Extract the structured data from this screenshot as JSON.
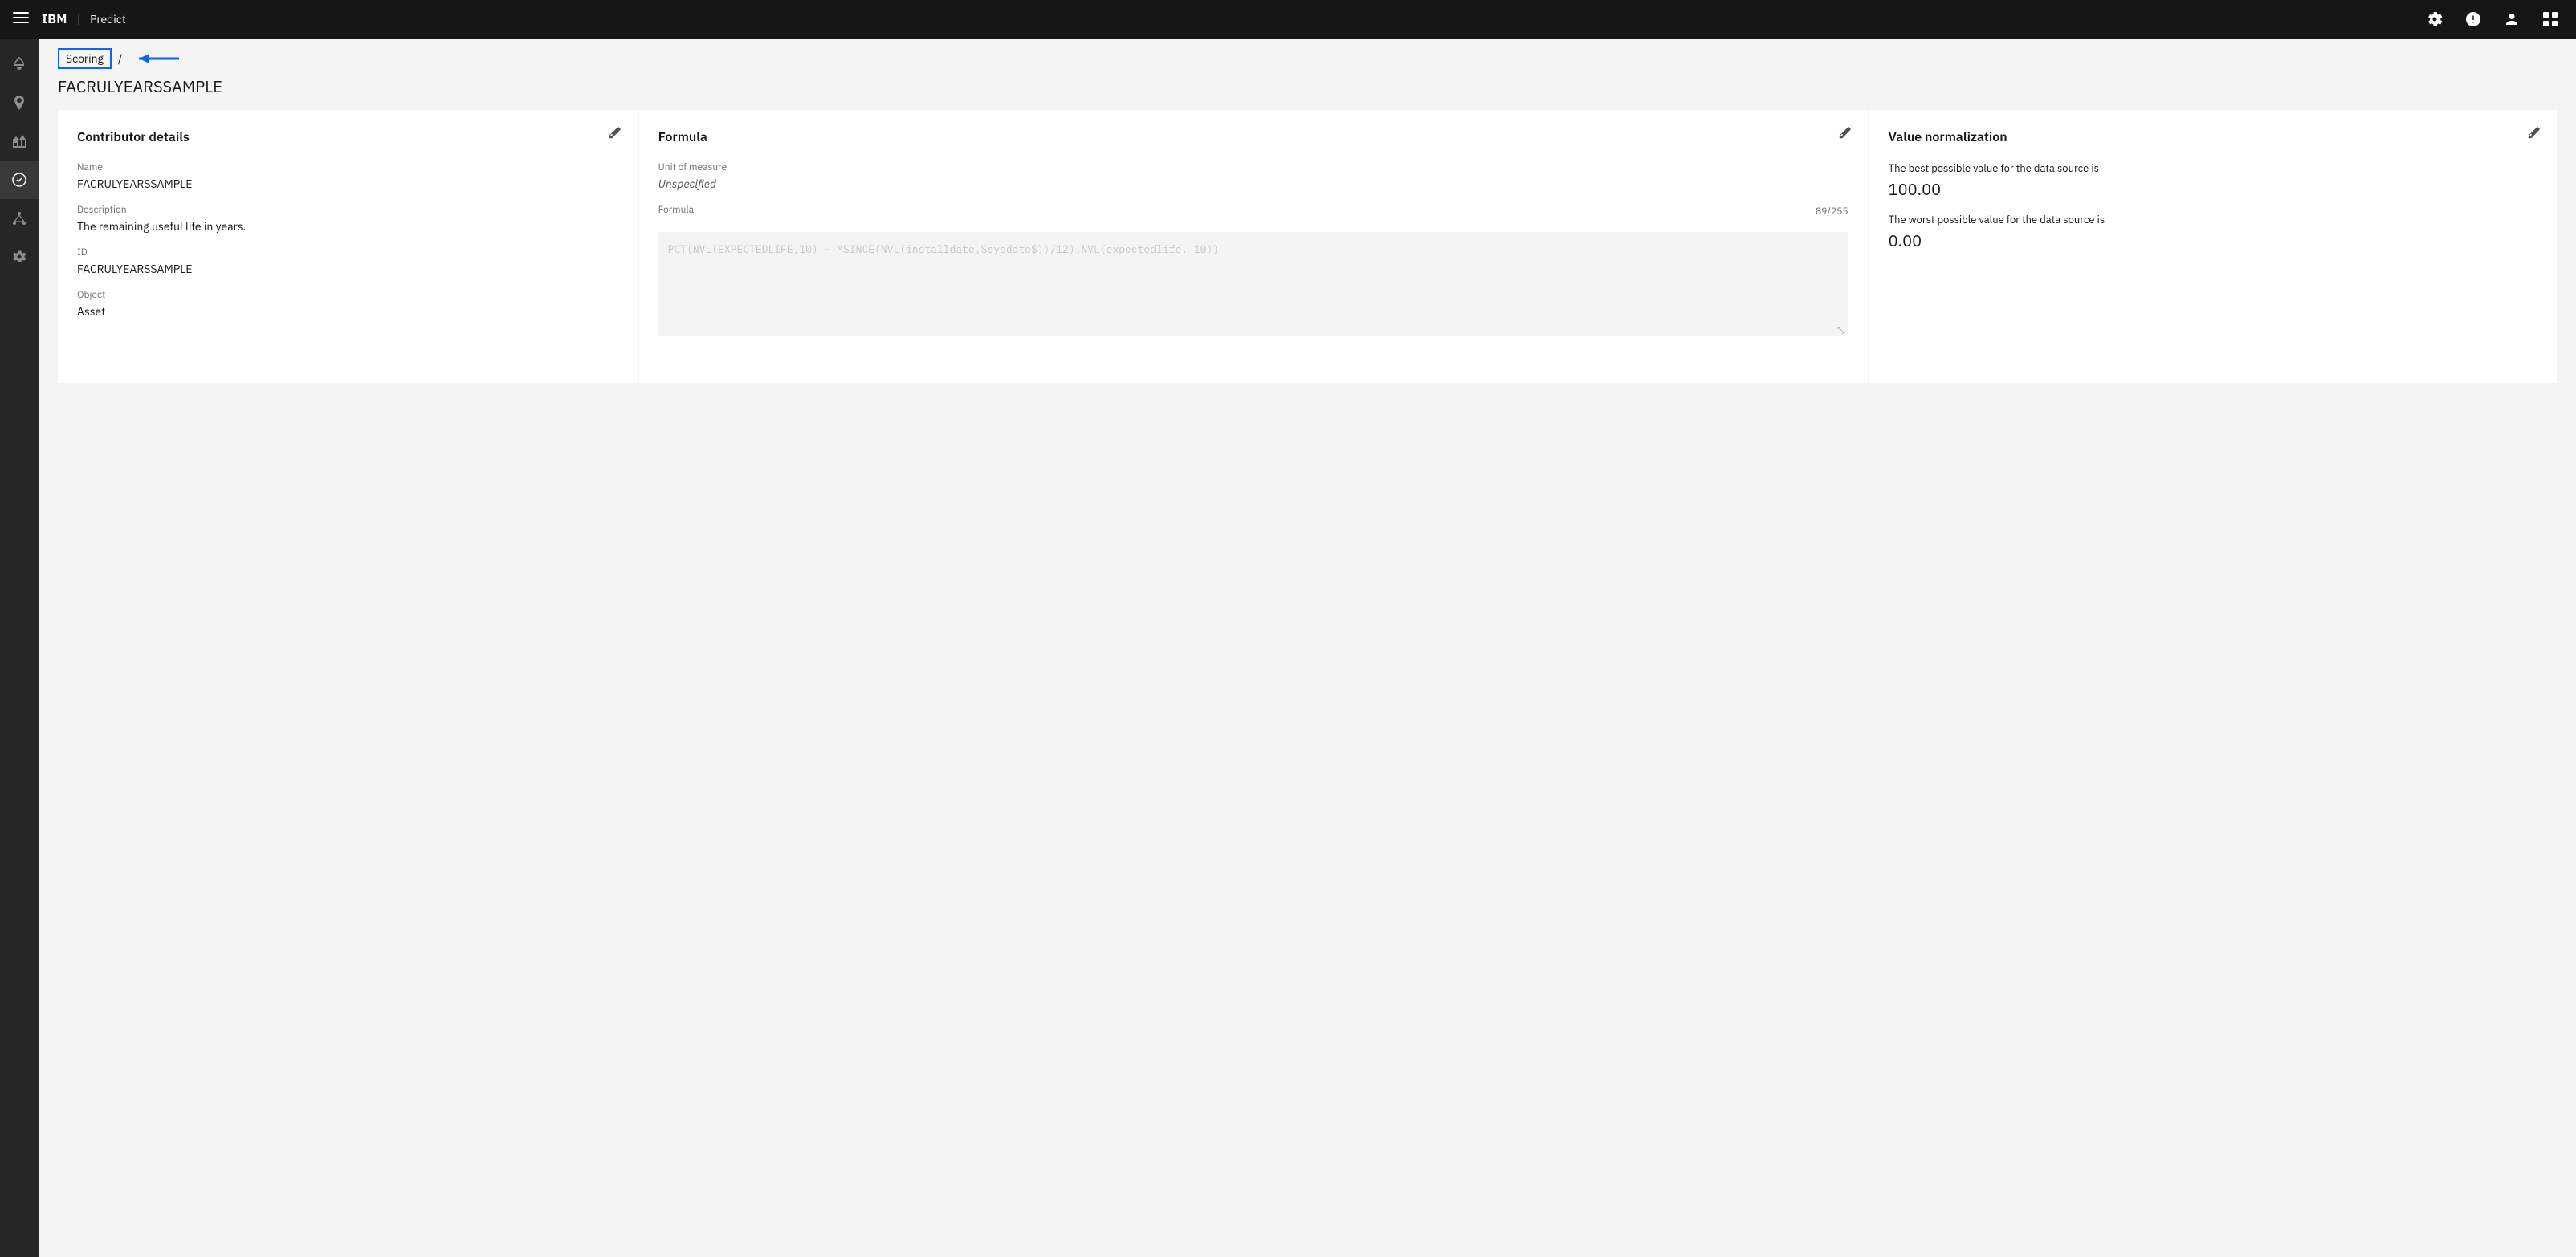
{
  "topNav": {
    "hamburger_label": "☰",
    "brand": "IBM",
    "divider": "|",
    "app": "Predict",
    "icons": {
      "settings": "⚙",
      "help": "?",
      "user": "👤",
      "apps": "⊞"
    }
  },
  "sidebar": {
    "items": [
      {
        "name": "rocket-icon",
        "label": "Launch",
        "active": false
      },
      {
        "name": "location-icon",
        "label": "Location",
        "active": false
      },
      {
        "name": "analytics-icon",
        "label": "Analytics",
        "active": false
      },
      {
        "name": "scoring-icon",
        "label": "Scoring",
        "active": true
      },
      {
        "name": "network-icon",
        "label": "Network",
        "active": false
      },
      {
        "name": "settings-icon",
        "label": "Settings",
        "active": false
      }
    ]
  },
  "breadcrumb": {
    "link_label": "Scoring",
    "separator": "/",
    "arrow_label": "←"
  },
  "page": {
    "title": "FACRULYEARSSAMPLE"
  },
  "contributorCard": {
    "title": "Contributor details",
    "edit_icon": "✏",
    "fields": {
      "name_label": "Name",
      "name_value": "FACRULYEARSSAMPLE",
      "description_label": "Description",
      "description_value": "The remaining useful life in years.",
      "id_label": "ID",
      "id_value": "FACRULYEARSSAMPLE",
      "object_label": "Object",
      "object_value": "Asset"
    }
  },
  "formulaCard": {
    "title": "Formula",
    "edit_icon": "✏",
    "unit_label": "Unit of measure",
    "unit_value": "Unspecified",
    "formula_label": "Formula",
    "formula_counter": "89/255",
    "formula_text": "PCT(NVL(EXPECTEDLIFE,10) - MSINCE(NVL(installdate,$sysdate$))/12),NVL(expectedlife, 10))"
  },
  "normalizationCard": {
    "title": "Value normalization",
    "edit_icon": "✏",
    "best_label": "The best possible value for the data source is",
    "best_value": "100.00",
    "worst_label": "The worst possible value for the data source is",
    "worst_value": "0.00"
  }
}
